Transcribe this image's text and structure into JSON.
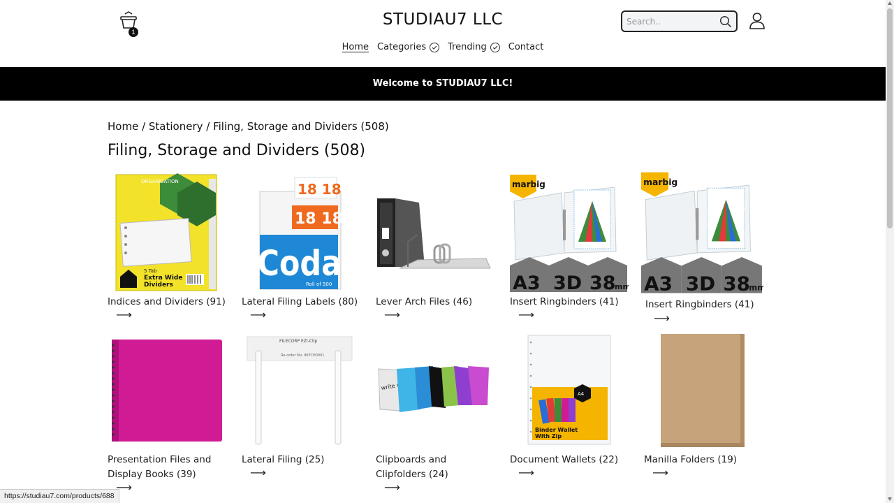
{
  "header": {
    "brand": "STUDIAU7 LLC",
    "cart_count": "1",
    "search_placeholder": "Search..",
    "nav": [
      {
        "label": "Home"
      },
      {
        "label": "Categories"
      },
      {
        "label": "Trending"
      },
      {
        "label": "Contact"
      }
    ]
  },
  "banner": {
    "text": "Welcome to STUDIAU7 LLC!"
  },
  "breadcrumb": {
    "home": "Home",
    "sep": " / ",
    "stationery": "Stationery",
    "current": "Filing, Storage and Dividers (508)"
  },
  "page_title": "Filing, Storage and Dividers (508)",
  "arrow": "⟶",
  "categories": [
    {
      "label": "Indices and Dividers (91)"
    },
    {
      "label": "Lateral Filing Labels (80)"
    },
    {
      "label": "Lever Arch Files (46)"
    },
    {
      "label": "Insert Ringbinders (41)"
    },
    {
      "label": "Insert Ringbinders (41)"
    },
    {
      "label": "Presentation Files and Display Books (39)"
    },
    {
      "label": "Lateral Filing (25)"
    },
    {
      "label": "Clipboards and Clipfolders (24)"
    },
    {
      "label": "Document Wallets (22)"
    },
    {
      "label": "Manilla Folders (19)"
    }
  ],
  "product_text": {
    "organisation": "ORGANISATION",
    "tab": "5 Tab",
    "extra_wide_1": "Extra Wide",
    "extra_wide_2": "Dividers",
    "roll_top": "18 18",
    "roll_mid": "18 18",
    "coda": "Coda",
    "roll_of": "Roll of 500",
    "marbig": "marbig",
    "a3": "A3",
    "d3": "3D",
    "mm": "38",
    "mm_unit": "mm",
    "filecorp": "FILECORP EZI-Clip",
    "reorder": "Re-order No: 96FCH0001",
    "write": "write on me!",
    "a4": "A4",
    "wallet_1": "Binder Wallet",
    "wallet_2": "With Zip"
  },
  "status_url": "https://studiau7.com/products/688",
  "colors": {
    "banner_bg": "#000000",
    "marbig_yellow": "#f5b400",
    "divider_yellow": "#f3e22a",
    "coda_blue": "#1e88d6",
    "label_orange": "#ef6a1f",
    "presentation_magenta": "#d01b95",
    "manilla": "#c6a37a"
  }
}
